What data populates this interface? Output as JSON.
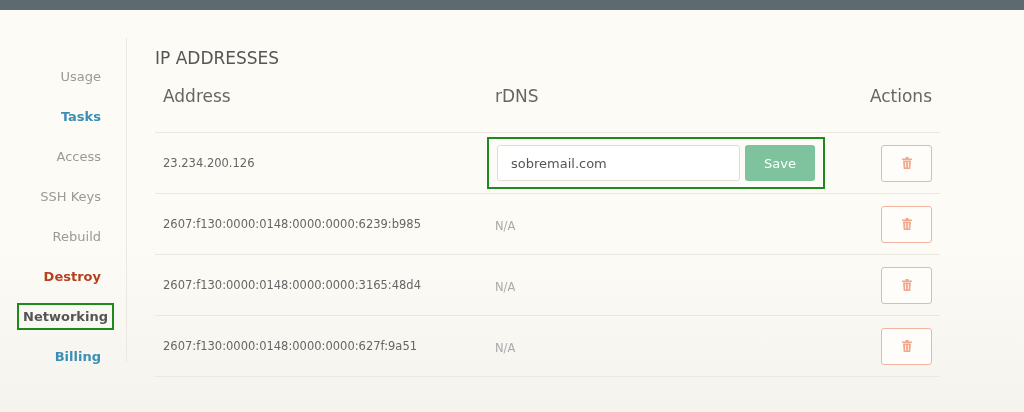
{
  "sidebar": {
    "items": [
      {
        "label": "Usage",
        "kind": "plain",
        "selected": false,
        "highlighted": false
      },
      {
        "label": "Tasks",
        "kind": "link",
        "selected": false,
        "highlighted": false
      },
      {
        "label": "Access",
        "kind": "plain",
        "selected": false,
        "highlighted": false
      },
      {
        "label": "SSH Keys",
        "kind": "plain",
        "selected": false,
        "highlighted": false
      },
      {
        "label": "Rebuild",
        "kind": "plain",
        "selected": false,
        "highlighted": false
      },
      {
        "label": "Destroy",
        "kind": "danger",
        "selected": false,
        "highlighted": false
      },
      {
        "label": "Networking",
        "kind": "plain",
        "selected": true,
        "highlighted": true
      },
      {
        "label": "Billing",
        "kind": "link",
        "selected": false,
        "highlighted": false
      }
    ]
  },
  "section_title": "IP ADDRESSES",
  "table": {
    "columns": [
      "Address",
      "rDNS",
      "Actions"
    ],
    "rows": [
      {
        "address": "23.234.200.126",
        "rdns": {
          "kind": "edit",
          "value": "sobremail.com",
          "button": "Save",
          "highlighted": true
        }
      },
      {
        "address": "2607:f130:0000:0148:0000:0000:6239:b985",
        "rdns": {
          "kind": "text",
          "text": "N/A"
        }
      },
      {
        "address": "2607:f130:0000:0148:0000:0000:3165:48d4",
        "rdns": {
          "kind": "text",
          "text": "N/A"
        }
      },
      {
        "address": "2607:f130:0000:0148:0000:0000:627f:9a51",
        "rdns": {
          "kind": "text",
          "text": "N/A"
        }
      }
    ]
  }
}
